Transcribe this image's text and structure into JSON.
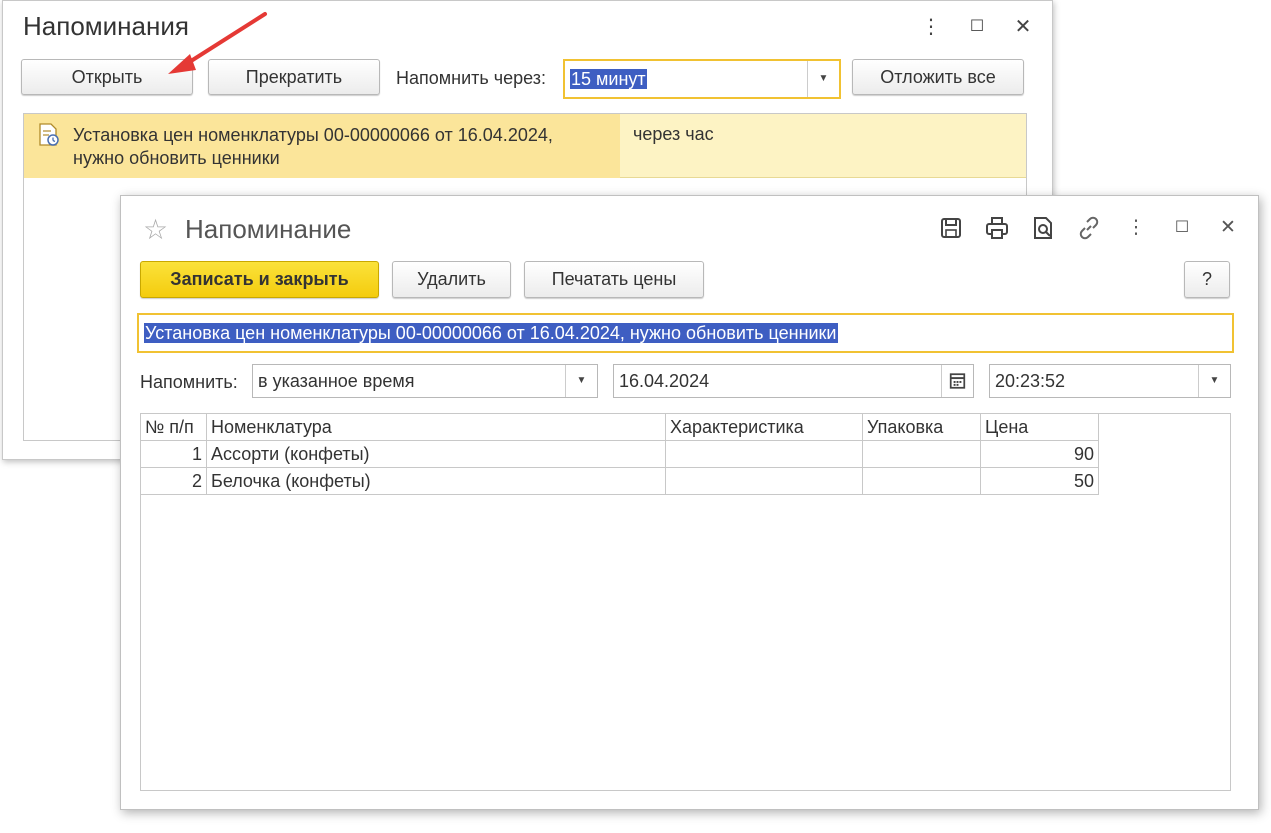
{
  "reminders_window": {
    "title": "Напоминания",
    "buttons": {
      "open": "Открыть",
      "stop": "Прекратить",
      "postpone_all": "Отложить все"
    },
    "remind_in_label": "Напомнить через:",
    "remind_in_value": "15 минут",
    "items": [
      {
        "text_line1": "Установка цен номенклатуры 00-00000066 от 16.04.2024,",
        "text_line2": "нужно обновить ценники",
        "when": "через час"
      }
    ]
  },
  "reminder_window": {
    "title": "Напоминание",
    "buttons": {
      "save_close": "Записать и закрыть",
      "delete": "Удалить",
      "print_prices": "Печатать цены",
      "help": "?"
    },
    "description": "Установка цен номенклатуры 00-00000066 от 16.04.2024, нужно обновить ценники",
    "remind_label": "Напомнить:",
    "remind_mode": "в указанное время",
    "date": "16.04.2024",
    "time": "20:23:52",
    "table": {
      "headers": [
        "№ п/п",
        "Номенклатура",
        "Характеристика",
        "Упаковка",
        "Цена"
      ],
      "rows": [
        [
          "1",
          "Ассорти (конфеты)",
          "",
          "",
          "90"
        ],
        [
          "2",
          "Белочка (конфеты)",
          "",
          "",
          "50"
        ]
      ]
    }
  },
  "colors": {
    "accent_yellow": "#f4cc0e",
    "selection_blue": "#3e5ec2",
    "row_highlight": "#fbe59a",
    "arrow_red": "#e53935"
  },
  "icons": [
    "more-icon",
    "maximize-icon",
    "close-icon",
    "reminder-doc-icon",
    "star-icon",
    "save-icon",
    "print-icon",
    "preview-icon",
    "link-icon",
    "calendar-icon",
    "dropdown-arrow-icon"
  ]
}
